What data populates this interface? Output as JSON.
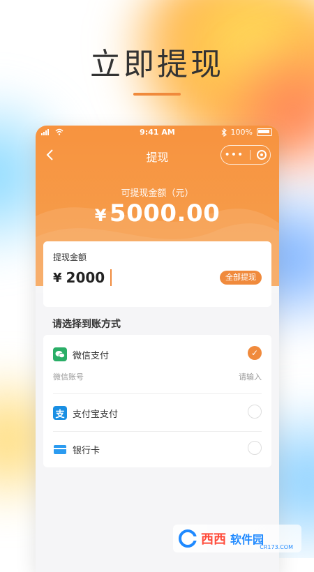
{
  "headline": "立即提现",
  "status_bar": {
    "time": "9:41 AM",
    "battery": "100%"
  },
  "navbar": {
    "back_icon": "chevron-left-icon",
    "title": "提现",
    "more": "•••"
  },
  "available": {
    "label": "可提现金额（元）",
    "currency": "¥",
    "amount": "5000.00"
  },
  "amount_card": {
    "label": "提现金额",
    "currency": "¥",
    "value": "2000",
    "all_button": "全部提现"
  },
  "payment_section": {
    "title": "请选择到账方式",
    "methods": [
      {
        "label": "微信支付",
        "icon": "wechat-pay-icon",
        "selected": true,
        "sub_label": "微信账号",
        "sub_hint": "请输入"
      },
      {
        "label": "支付宝支付",
        "icon": "alipay-icon",
        "icon_char": "支",
        "selected": false
      },
      {
        "label": "银行卡",
        "icon": "bank-card-icon",
        "selected": false
      }
    ]
  },
  "watermark": {
    "brand": "西西软件园",
    "brand_part1": "西西",
    "brand_part2": "软件园",
    "site": "CR173.COM"
  },
  "colors": {
    "accent": "#f08a3c",
    "wechat": "#2aae67",
    "alipay": "#1a8fe3"
  }
}
